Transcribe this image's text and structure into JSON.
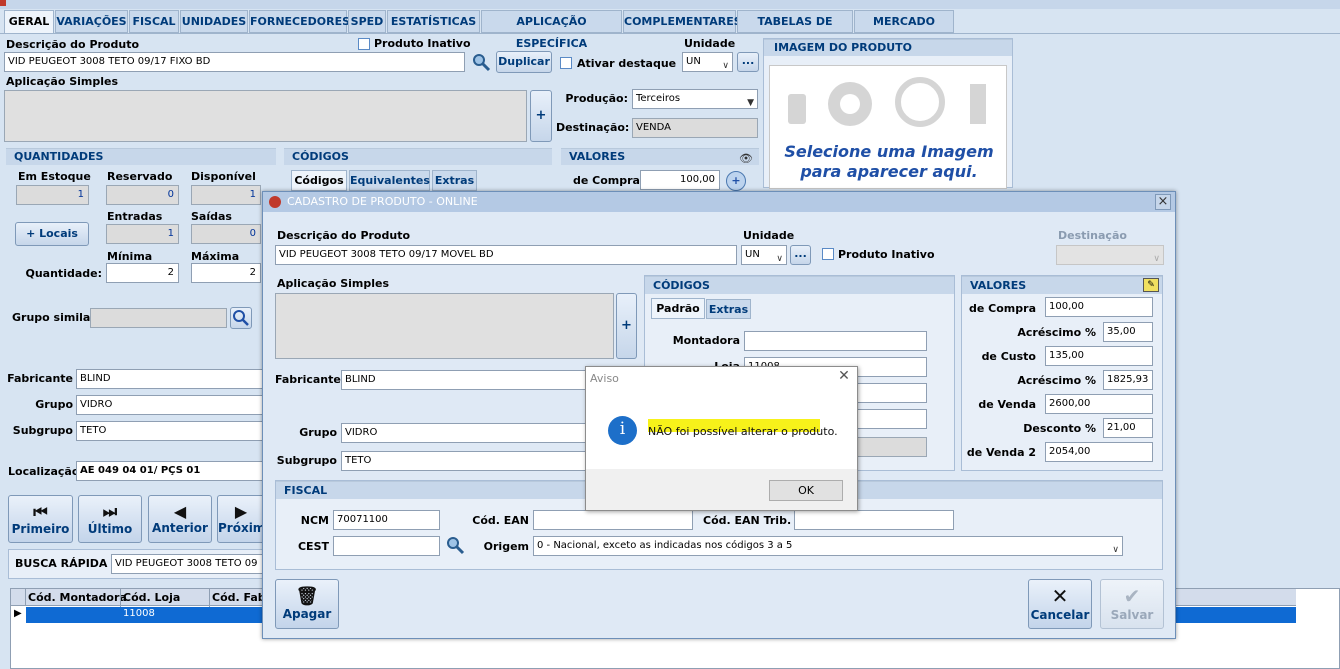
{
  "tabs": [
    "GERAL",
    "VARIAÇÕES",
    "FISCAL",
    "UNIDADES",
    "FORNECEDORES",
    "SPED",
    "ESTATÍSTICAS",
    "APLICAÇÃO ESPECÍFICA",
    "COMPLEMENTARES",
    "TABELAS DE PREÇO",
    "MERCADO LIVRE"
  ],
  "main": {
    "descricao_label": "Descrição do Produto",
    "descricao_value": "VID PEUGEOT 3008 TETO 09/17 FIXO BD",
    "produto_inativo": "Produto Inativo",
    "unidade_label": "Unidade",
    "unidade_value": "UN",
    "duplicar": "Duplicar",
    "ativar_destaque": "Ativar destaque",
    "more": "...",
    "aplicacao_label": "Aplicação Simples",
    "plus": "+",
    "producao_label": "Produção:",
    "producao_value": "Terceiros",
    "destinacao_label": "Destinação:",
    "destinacao_value": "VENDA",
    "imagem_header": "IMAGEM DO PRODUTO",
    "imagem_text1": "Selecione uma Imagem",
    "imagem_text2": "para aparecer aqui.",
    "quantidades_header": "QUANTIDADES",
    "em_estoque": "Em Estoque",
    "reservado": "Reservado",
    "disponivel": "Disponível",
    "em_estoque_val": "1",
    "reservado_val": "0",
    "disponivel_val": "1",
    "entradas": "Entradas",
    "saidas": "Saídas",
    "entradas_val": "1",
    "saidas_val": "0",
    "locais": "+ Locais",
    "minima": "Mínima",
    "maxima": "Máxima",
    "quantidade_label": "Quantidade:",
    "minima_val": "2",
    "maxima_val": "2",
    "codigos_header": "CÓDIGOS",
    "cod_tabs": [
      "Códigos",
      "Equivalentes",
      "Extras"
    ],
    "valores_header": "VALORES",
    "de_compra": "de Compra",
    "de_compra_val": "100,00",
    "grupo_similar": "Grupo similar",
    "fabricante": "Fabricante",
    "fabricante_val": "BLIND",
    "grupo": "Grupo",
    "grupo_val": "VIDRO",
    "subgrupo": "Subgrupo",
    "subgrupo_val": "TETO",
    "localizacao": "Localização",
    "localizacao_val": "AE 049 04 01/ PÇS 01",
    "nav": [
      "Primeiro",
      "Último",
      "Anterior",
      "Próxim"
    ],
    "busca_label": "BUSCA RÁPIDA",
    "busca_val": "VID PEUGEOT 3008 TETO 09",
    "grid_cols": [
      "Cód. Montadora",
      "Cód. Loja",
      "Cód. Fab."
    ],
    "grid_row": [
      "",
      "11008",
      ""
    ]
  },
  "dialog": {
    "title": "CADASTRO DE PRODUTO - ONLINE",
    "close": "×",
    "descricao_label": "Descrição do Produto",
    "descricao_value": "VID PEUGEOT 3008 TETO 09/17 MOVEL BD",
    "unidade_label": "Unidade",
    "unidade_value": "UN",
    "more": "...",
    "produto_inativo": "Produto Inativo",
    "destinacao_label": "Destinação",
    "aplicacao_label": "Aplicação Simples",
    "plus": "+",
    "codigos_header": "CÓDIGOS",
    "cod_tabs": [
      "Padrão",
      "Extras"
    ],
    "montadora": "Montadora",
    "loja": "Loja",
    "loja_val": "11008",
    "fabricante": "Fabricante",
    "fabricante_val": "BLIND",
    "grupo": "Grupo",
    "grupo_val": "VIDRO",
    "subgrupo": "Subgrupo",
    "subgrupo_val": "TETO",
    "valores_header": "VALORES",
    "valores": [
      {
        "label": "de Compra",
        "value": "100,00"
      },
      {
        "label": "Acréscimo %",
        "value": "35,00"
      },
      {
        "label": "de Custo",
        "value": "135,00"
      },
      {
        "label": "Acréscimo %",
        "value": "1825,93"
      },
      {
        "label": "de Venda",
        "value": "2600,00"
      },
      {
        "label": "Desconto %",
        "value": "21,00"
      },
      {
        "label": "de Venda 2",
        "value": "2054,00"
      }
    ],
    "fiscal_header": "FISCAL",
    "ncm_label": "NCM",
    "ncm_val": "70071100",
    "cod_ean_label": "Cód. EAN",
    "cod_ean_trib_label": "Cód. EAN Trib.",
    "cest_label": "CEST",
    "origem_label": "Origem",
    "origem_val": "0 - Nacional, exceto as indicadas nos códigos 3 a 5",
    "apagar": "Apagar",
    "cancelar": "Cancelar",
    "salvar": "Salvar"
  },
  "aviso": {
    "title": "Aviso",
    "message": "NÃO foi possível alterar o produto.",
    "ok": "OK"
  }
}
